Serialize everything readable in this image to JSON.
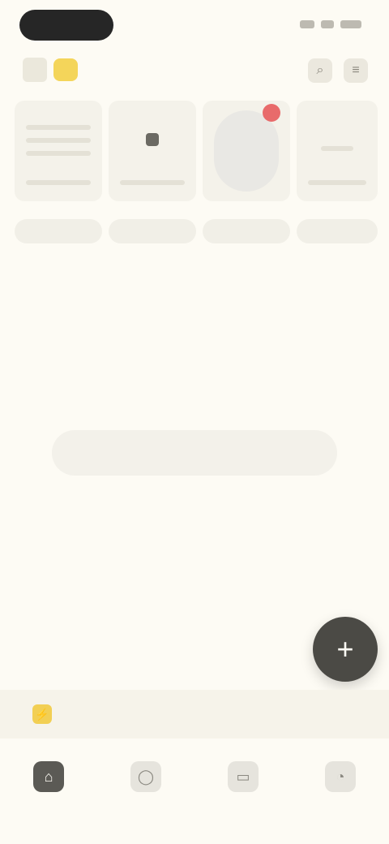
{
  "status_bar": {
    "time": ""
  },
  "topbar": {
    "title": "",
    "actions": [
      {
        "icon": "search-icon",
        "glyph": "⌕"
      },
      {
        "icon": "menu-icon",
        "glyph": "≡"
      }
    ]
  },
  "cards": [
    {
      "label": ""
    },
    {
      "label": ""
    },
    {
      "label": ""
    },
    {
      "label": ""
    }
  ],
  "empty_state": {
    "title": "",
    "description": "",
    "button_label": ""
  },
  "fab": {
    "icon": "plus-icon",
    "glyph": "+"
  },
  "banner": {
    "icon": "lightning-icon",
    "glyph": "⚡",
    "text": ""
  },
  "bottom_nav": [
    {
      "icon": "home-icon",
      "glyph": "⌂",
      "label": ""
    },
    {
      "icon": "chat-icon",
      "glyph": "◯",
      "label": ""
    },
    {
      "icon": "library-icon",
      "glyph": "▭",
      "label": ""
    },
    {
      "icon": "profile-icon",
      "glyph": "◔",
      "label": ""
    }
  ],
  "colors": {
    "background": "#fdfbf4",
    "accent": "#f4d55a",
    "fab": "#4b4a45",
    "badge": "#e86b6b"
  }
}
